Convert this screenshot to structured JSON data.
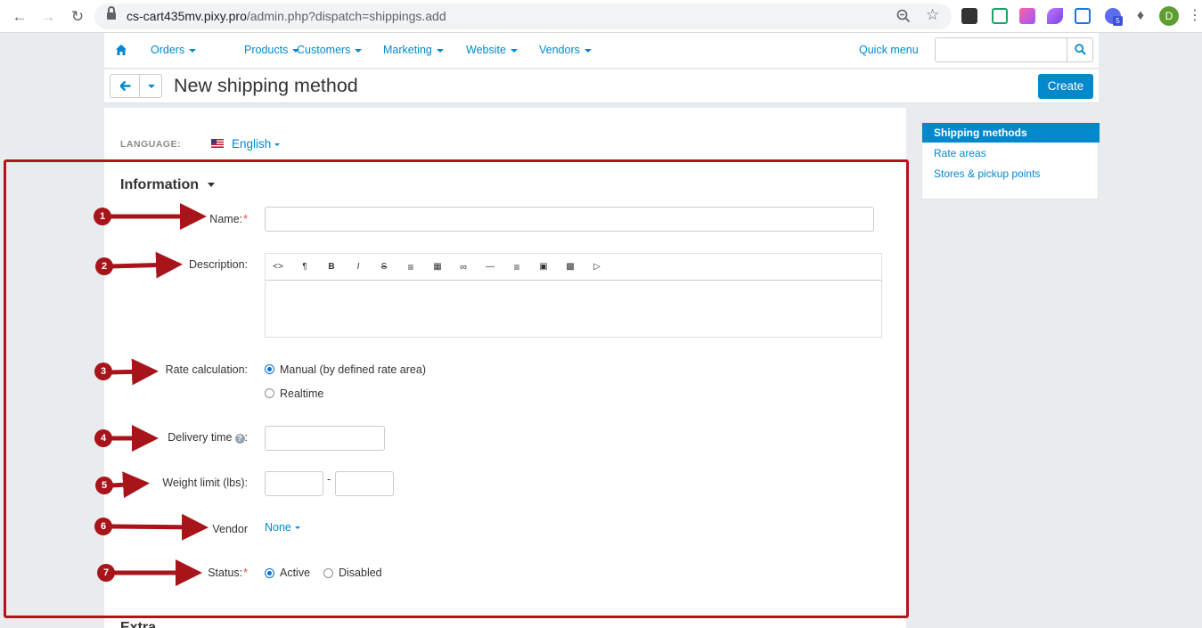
{
  "browser": {
    "url_host": "cs-cart435mv.pixy.pro",
    "url_path": "/admin.php?dispatch=shippings.add",
    "avatar_letter": "D",
    "ext_badge": "5"
  },
  "topmenu": {
    "items": [
      "Orders",
      "Products",
      "Customers",
      "Marketing",
      "Website",
      "Vendors"
    ],
    "quick_menu": "Quick menu",
    "search_placeholder": ""
  },
  "header": {
    "title": "New shipping method",
    "create_label": "Create"
  },
  "language": {
    "label": "LANGUAGE:",
    "value": "English"
  },
  "form": {
    "section_title": "Information",
    "name_label": "Name:",
    "description_label": "Description:",
    "rate_label": "Rate calculation:",
    "rate_options": [
      "Manual (by defined rate area)",
      "Realtime"
    ],
    "delivery_label": "Delivery time",
    "weight_label": "Weight limit (lbs):",
    "weight_sep": "-",
    "vendor_label": "Vendor",
    "vendor_value": "None",
    "status_label": "Status:",
    "status_options": [
      "Active",
      "Disabled"
    ],
    "required_mark": "*",
    "next_section": "Extra"
  },
  "editor_toolbar": [
    "code-view",
    "paragraph",
    "bold",
    "italic",
    "strikethrough",
    "bullet-list",
    "numbered-list",
    "link",
    "horizontal-rule",
    "align",
    "font-color",
    "image",
    "video"
  ],
  "sidebar": {
    "items": [
      "Shipping methods",
      "Rate areas",
      "Stores & pickup points"
    ]
  },
  "annotations": {
    "numbers": [
      "1",
      "2",
      "3",
      "4",
      "5",
      "6",
      "7"
    ],
    "color": "#a7141a"
  },
  "colors": {
    "accent": "#0388cc",
    "required": "#e54d42"
  }
}
